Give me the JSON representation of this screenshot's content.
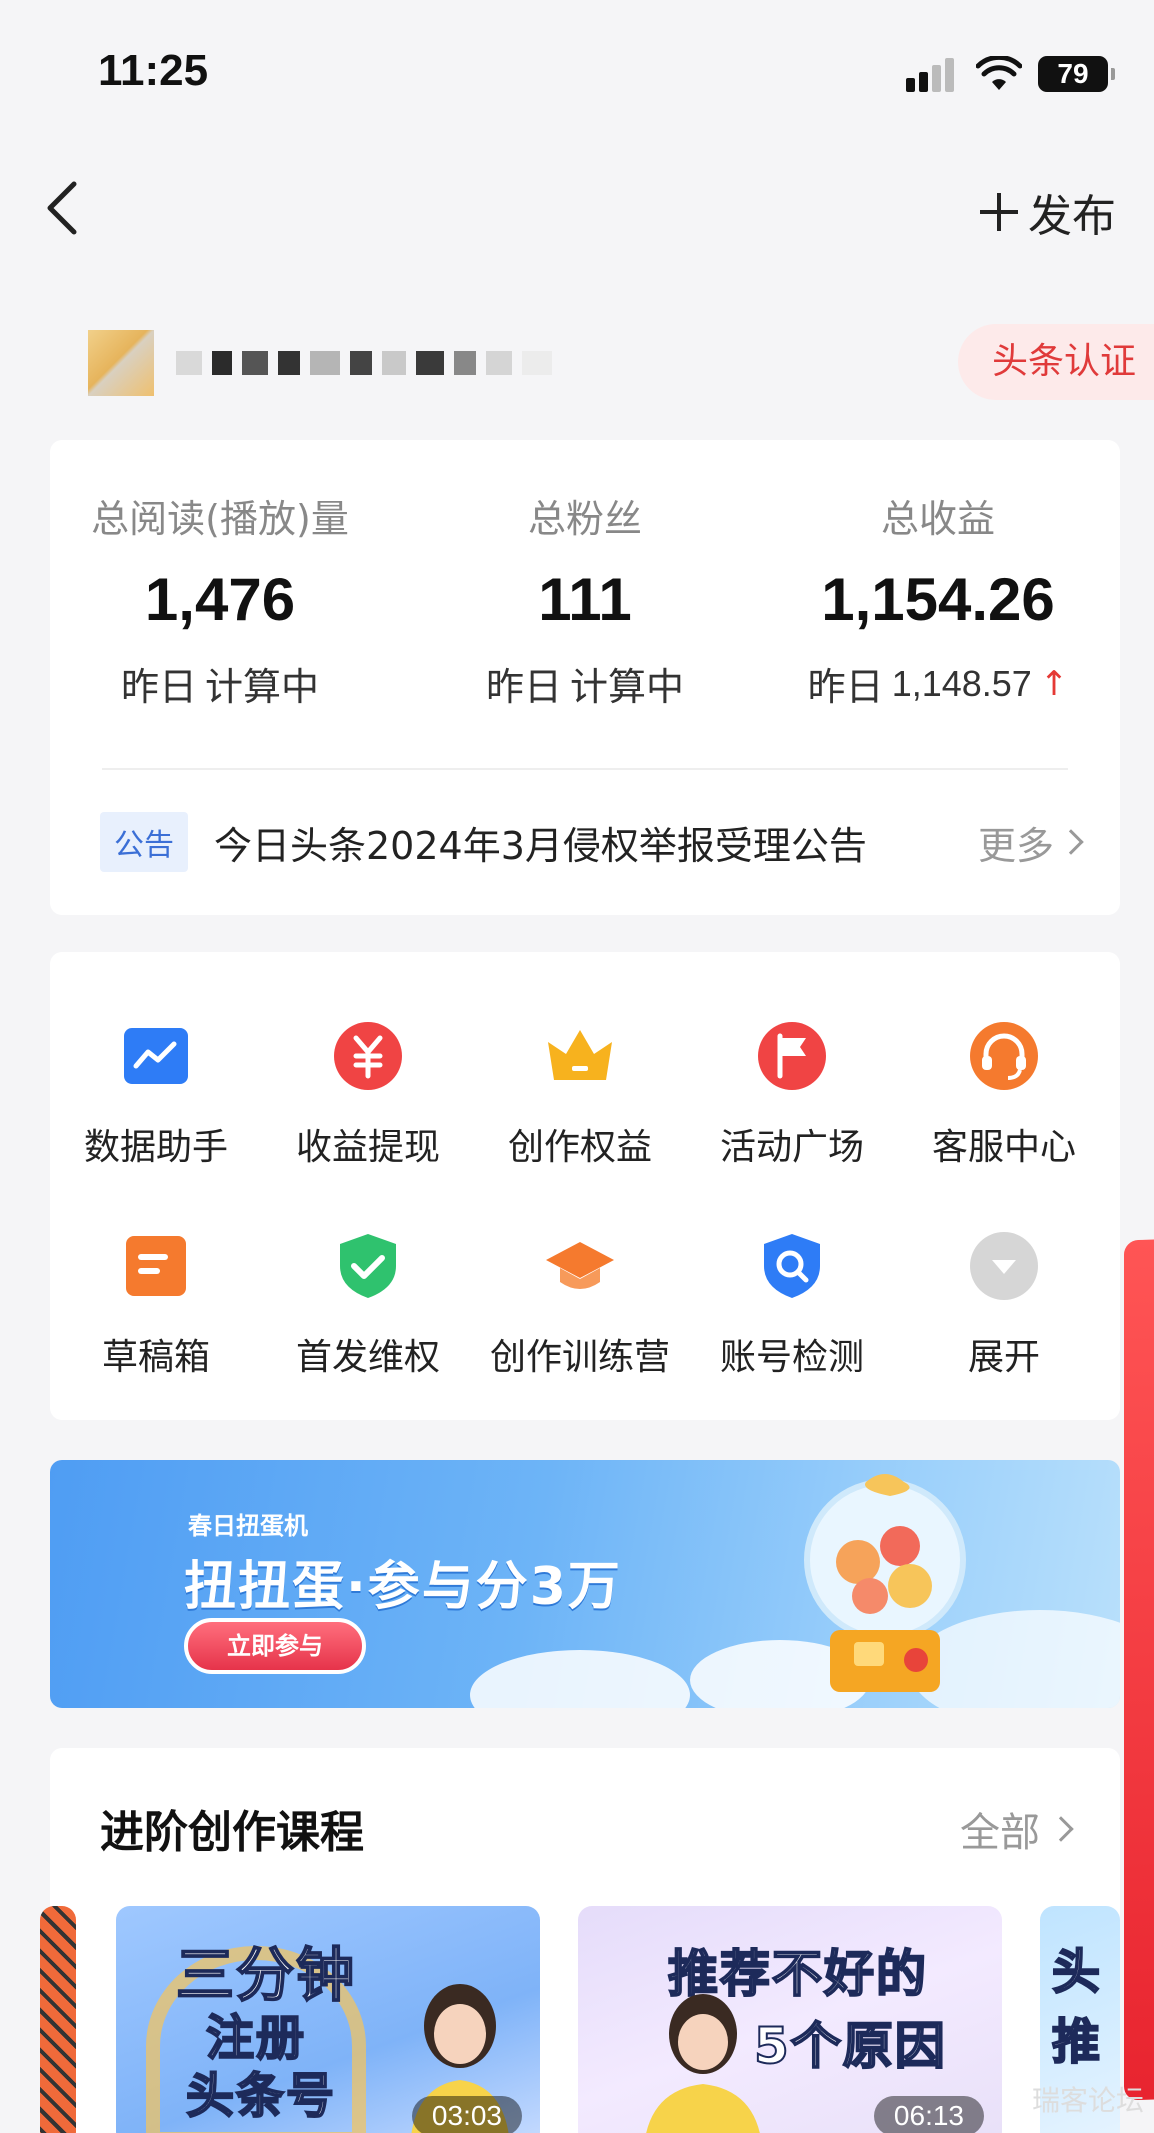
{
  "status_bar": {
    "time": "11:25",
    "battery": "79"
  },
  "nav": {
    "publish_label": "发布"
  },
  "profile": {
    "verify_badge": "头条认证"
  },
  "stats": [
    {
      "label": "总阅读(播放)量",
      "value": "1,476",
      "sub_prefix": "昨日",
      "sub_value": "计算中",
      "trend": ""
    },
    {
      "label": "总粉丝",
      "value": "111",
      "sub_prefix": "昨日",
      "sub_value": "计算中",
      "trend": ""
    },
    {
      "label": "总收益",
      "value": "1,154.26",
      "sub_prefix": "昨日",
      "sub_value": "1,148.57",
      "trend": "up"
    }
  ],
  "notice": {
    "tag": "公告",
    "text": "今日头条2024年3月侵权举报受理公告",
    "more": "更多"
  },
  "tools": [
    {
      "label": "数据助手",
      "icon": "chart-icon",
      "color": "#2e7cf6"
    },
    {
      "label": "收益提现",
      "icon": "yuan-icon",
      "color": "#f04444"
    },
    {
      "label": "创作权益",
      "icon": "crown-icon",
      "color": "#f7b21e"
    },
    {
      "label": "活动广场",
      "icon": "flag-icon",
      "color": "#f04444"
    },
    {
      "label": "客服中心",
      "icon": "headset-icon",
      "color": "#f57a2e"
    },
    {
      "label": "草稿箱",
      "icon": "draft-icon",
      "color": "#f57a2e"
    },
    {
      "label": "首发维权",
      "icon": "shield-check-icon",
      "color": "#2fc26e"
    },
    {
      "label": "创作训练营",
      "icon": "graduation-cap-icon",
      "color": "#f57a2e"
    },
    {
      "label": "账号检测",
      "icon": "shield-search-icon",
      "color": "#2e7cf6"
    },
    {
      "label": "展开",
      "icon": "expand-icon",
      "color": "#cfcfcf"
    }
  ],
  "banner": {
    "subtitle": "春日扭蛋机",
    "title": "扭扭蛋·参与分3万",
    "button": "立即参与"
  },
  "courses": {
    "title": "进阶创作课程",
    "all_label": "全部",
    "items": [
      {
        "line1": "三分钟",
        "line2": "注册",
        "line3": "头条号",
        "duration": "03:03"
      },
      {
        "line1": "推荐不好的",
        "line2": "5个原因",
        "duration": "06:13"
      },
      {
        "line1": "头",
        "line2": "推"
      }
    ]
  },
  "watermark": "瑞客论坛"
}
